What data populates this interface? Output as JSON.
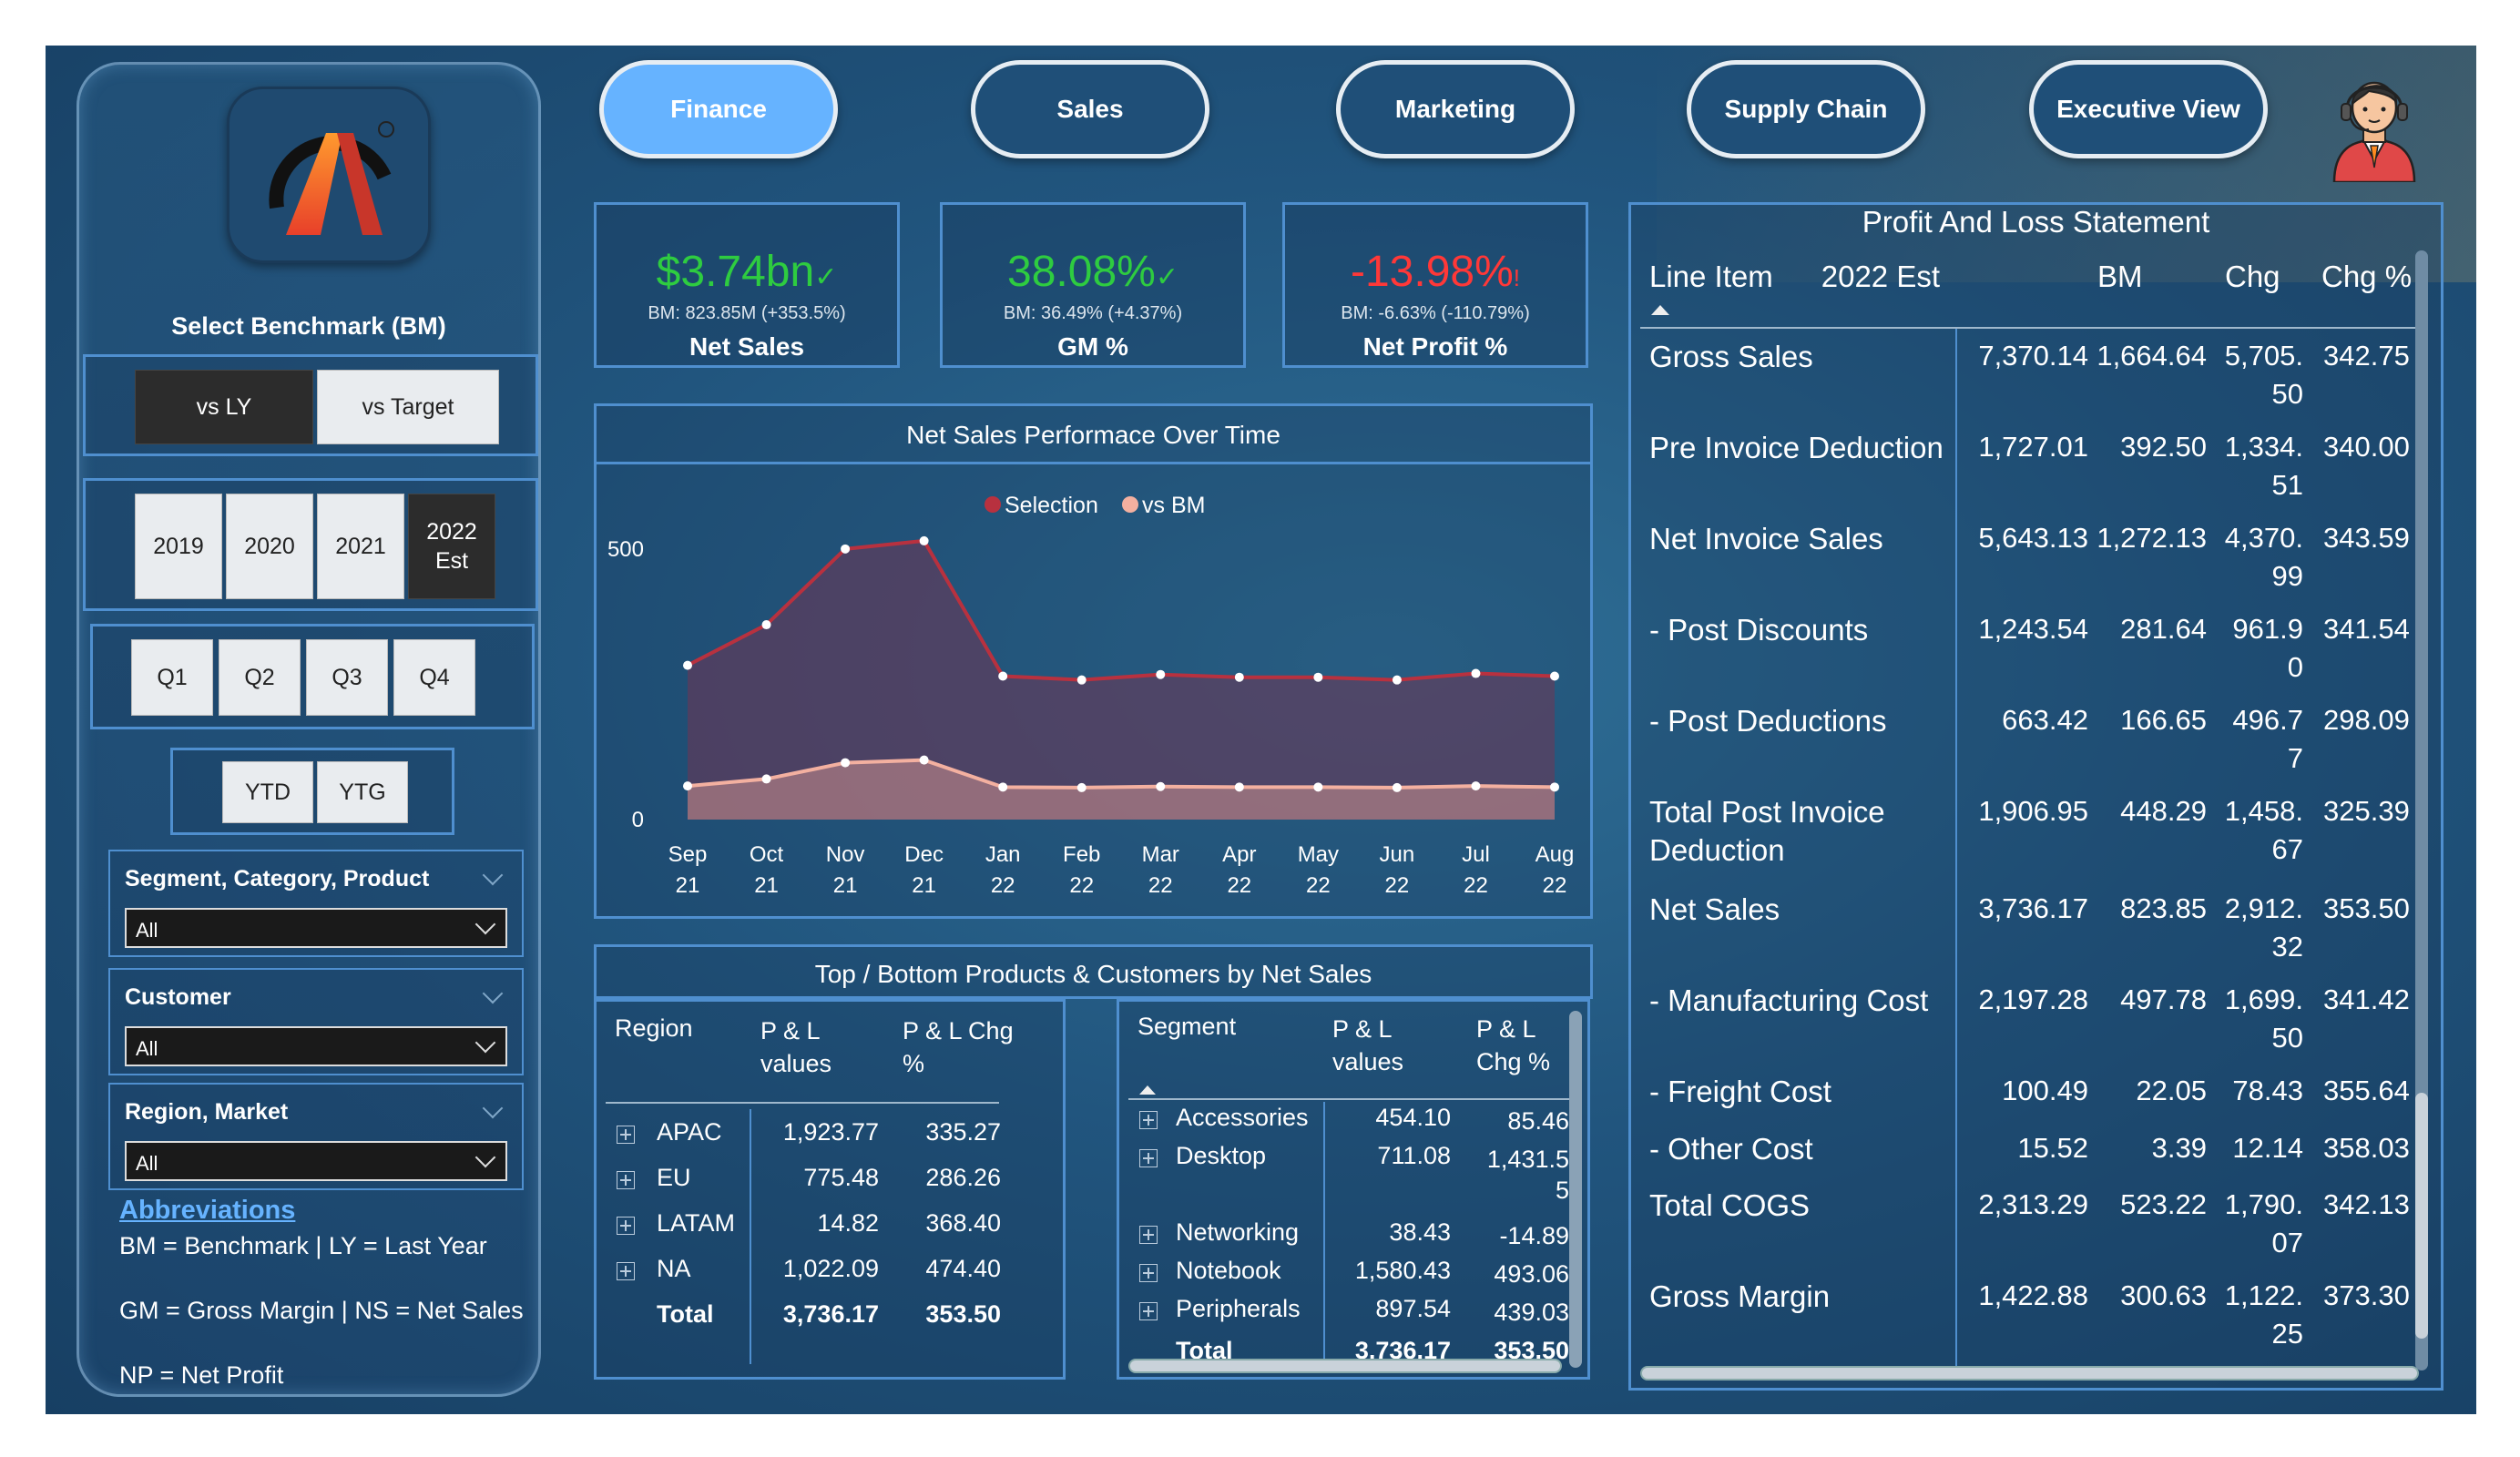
{
  "nav": {
    "tabs": [
      "Finance",
      "Sales",
      "Marketing",
      "Supply Chain",
      "Executive View"
    ],
    "active": "Finance"
  },
  "sidebar": {
    "select_benchmark": "Select Benchmark (BM)",
    "benchmark_options": [
      "vs LY",
      "vs Target"
    ],
    "years": [
      "2019",
      "2020",
      "2021",
      "2022 Est"
    ],
    "quarters": [
      "Q1",
      "Q2",
      "Q3",
      "Q4"
    ],
    "periods": [
      "YTD",
      "YTG"
    ],
    "filters": [
      {
        "label": "Segment, Category, Product",
        "value": "All"
      },
      {
        "label": "Customer",
        "value": "All"
      },
      {
        "label": "Region, Market",
        "value": "All"
      }
    ],
    "abbreviations": {
      "heading": "Abbreviations",
      "lines": [
        "BM = Benchmark | LY = Last Year",
        "GM = Gross Margin | NS = Net Sales",
        "NP = Net Profit"
      ]
    }
  },
  "kpis": [
    {
      "value": "$3.74bn",
      "indicator": "✓",
      "bm": "BM: 823.85M (+353.5%)",
      "name": "Net Sales",
      "status": "green"
    },
    {
      "value": "38.08%",
      "indicator": "✓",
      "bm": "BM: 36.49% (+4.37%)",
      "name": "GM %",
      "status": "green"
    },
    {
      "value": "-13.98%",
      "indicator": "!",
      "bm": "BM: -6.63% (-110.79%)",
      "name": "Net Profit %",
      "status": "red"
    }
  ],
  "colors": {
    "selection": "#b8313f",
    "bm": "#f3b0a0",
    "accent": "#66b3ff",
    "kpi_green": "#2ecc40",
    "kpi_red": "#ff3838"
  },
  "chart_data": {
    "type": "area",
    "title": "Net Sales Performace Over Time",
    "legend": [
      "Selection",
      "vs BM"
    ],
    "legend_position": "top-center",
    "x": [
      "Sep 21",
      "Oct 21",
      "Nov 21",
      "Dec 21",
      "Jan 22",
      "Feb 22",
      "Mar 22",
      "Apr 22",
      "May 22",
      "Jun 22",
      "Jul 22",
      "Aug 22"
    ],
    "series": [
      {
        "name": "Selection",
        "values": [
          285,
          360,
          500,
          515,
          265,
          258,
          268,
          263,
          263,
          258,
          270,
          265
        ]
      },
      {
        "name": "vs BM",
        "values": [
          62,
          75,
          105,
          110,
          60,
          59,
          61,
          60,
          60,
          59,
          62,
          60
        ]
      }
    ],
    "yticks": [
      "0",
      "500"
    ],
    "ylim": [
      0,
      530
    ],
    "grid": false
  },
  "topbottom": {
    "title": "Top / Bottom Products & Customers by Net Sales",
    "region_table": {
      "headers": [
        "Region",
        "P & L values",
        "P & L Chg %"
      ],
      "rows": [
        [
          "APAC",
          "1,923.77",
          "335.27"
        ],
        [
          "EU",
          "775.48",
          "286.26"
        ],
        [
          "LATAM",
          "14.82",
          "368.40"
        ],
        [
          "NA",
          "1,022.09",
          "474.40"
        ]
      ],
      "total": [
        "Total",
        "3,736.17",
        "353.50"
      ]
    },
    "segment_table": {
      "headers": [
        "Segment",
        "P & L values",
        "P & L Chg %"
      ],
      "rows": [
        [
          "Accessories",
          "454.10",
          "85.46"
        ],
        [
          "Desktop",
          "711.08",
          "1,431.5 5"
        ],
        [
          "Networking",
          "38.43",
          "-14.89"
        ],
        [
          "Notebook",
          "1,580.43",
          "493.06"
        ],
        [
          "Peripherals",
          "897.54",
          "439.03"
        ]
      ],
      "total": [
        "Total",
        "3,736.17",
        "353.50"
      ]
    }
  },
  "pl": {
    "title": "Profit And Loss Statement",
    "headers": [
      "Line Item",
      "2022 Est",
      "BM",
      "Chg",
      "Chg %"
    ],
    "rows": [
      [
        "Gross Sales",
        "7,370.14",
        "1,664.64",
        "5,705.|50",
        "342.75"
      ],
      [
        "Pre Invoice Deduction",
        "1,727.01",
        "392.50",
        "1,334.|51",
        "340.00"
      ],
      [
        "Net Invoice Sales",
        "5,643.13",
        "1,272.13",
        "4,370.|99",
        "343.59"
      ],
      [
        "- Post Discounts",
        "1,243.54",
        "281.64",
        "961.9|0",
        "341.54"
      ],
      [
        "- Post Deductions",
        "663.42",
        "166.65",
        "496.7|7",
        "298.09"
      ],
      [
        "Total Post Invoice|Deduction",
        "1,906.95",
        "448.29",
        "1,458.|67",
        "325.39"
      ],
      [
        "Net Sales",
        "3,736.17",
        "823.85",
        "2,912.|32",
        "353.50"
      ],
      [
        "- Manufacturing Cost",
        "2,197.28",
        "497.78",
        "1,699.|50",
        "341.42"
      ],
      [
        "- Freight Cost",
        "100.49",
        "22.05",
        "78.43",
        "355.64"
      ],
      [
        "- Other Cost",
        "15.52",
        "3.39",
        "12.14",
        "358.03"
      ],
      [
        "Total COGS",
        "2,313.29",
        "523.22",
        "1,790.|07",
        "342.13"
      ],
      [
        "Gross Margin",
        "1,422.88",
        "300.63",
        "1,122.|25",
        "373.30"
      ]
    ]
  }
}
